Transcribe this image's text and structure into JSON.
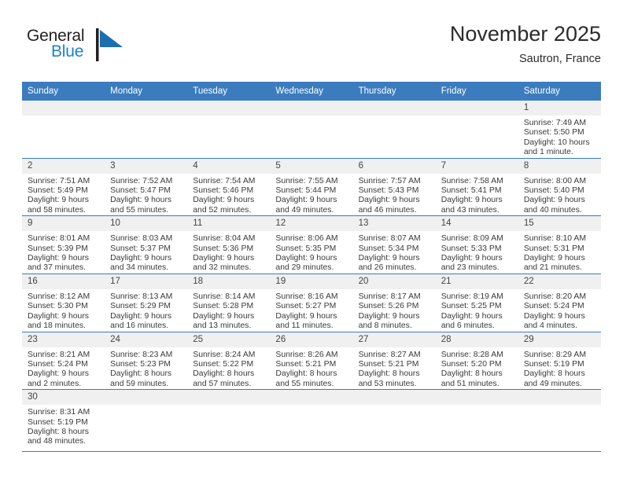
{
  "brand": {
    "name_part1": "General",
    "name_part2": "Blue",
    "flag_icon": "blue-flag-triangle",
    "color_black": "#231f20",
    "color_blue": "#1b82cb"
  },
  "header": {
    "title": "November 2025",
    "subtitle": "Sautron, France"
  },
  "theme": {
    "header_blue": "#3b7cbf",
    "daynum_gray": "#f0f0f0",
    "text": "#3a3a3a"
  },
  "weekdays": [
    "Sunday",
    "Monday",
    "Tuesday",
    "Wednesday",
    "Thursday",
    "Friday",
    "Saturday"
  ],
  "weeks": [
    [
      {
        "day": "",
        "empty": true
      },
      {
        "day": "",
        "empty": true
      },
      {
        "day": "",
        "empty": true
      },
      {
        "day": "",
        "empty": true
      },
      {
        "day": "",
        "empty": true
      },
      {
        "day": "",
        "empty": true
      },
      {
        "day": "1",
        "sunrise": "Sunrise: 7:49 AM",
        "sunset": "Sunset: 5:50 PM",
        "daylight1": "Daylight: 10 hours",
        "daylight2": "and 1 minute."
      }
    ],
    [
      {
        "day": "2",
        "sunrise": "Sunrise: 7:51 AM",
        "sunset": "Sunset: 5:49 PM",
        "daylight1": "Daylight: 9 hours",
        "daylight2": "and 58 minutes."
      },
      {
        "day": "3",
        "sunrise": "Sunrise: 7:52 AM",
        "sunset": "Sunset: 5:47 PM",
        "daylight1": "Daylight: 9 hours",
        "daylight2": "and 55 minutes."
      },
      {
        "day": "4",
        "sunrise": "Sunrise: 7:54 AM",
        "sunset": "Sunset: 5:46 PM",
        "daylight1": "Daylight: 9 hours",
        "daylight2": "and 52 minutes."
      },
      {
        "day": "5",
        "sunrise": "Sunrise: 7:55 AM",
        "sunset": "Sunset: 5:44 PM",
        "daylight1": "Daylight: 9 hours",
        "daylight2": "and 49 minutes."
      },
      {
        "day": "6",
        "sunrise": "Sunrise: 7:57 AM",
        "sunset": "Sunset: 5:43 PM",
        "daylight1": "Daylight: 9 hours",
        "daylight2": "and 46 minutes."
      },
      {
        "day": "7",
        "sunrise": "Sunrise: 7:58 AM",
        "sunset": "Sunset: 5:41 PM",
        "daylight1": "Daylight: 9 hours",
        "daylight2": "and 43 minutes."
      },
      {
        "day": "8",
        "sunrise": "Sunrise: 8:00 AM",
        "sunset": "Sunset: 5:40 PM",
        "daylight1": "Daylight: 9 hours",
        "daylight2": "and 40 minutes."
      }
    ],
    [
      {
        "day": "9",
        "sunrise": "Sunrise: 8:01 AM",
        "sunset": "Sunset: 5:39 PM",
        "daylight1": "Daylight: 9 hours",
        "daylight2": "and 37 minutes."
      },
      {
        "day": "10",
        "sunrise": "Sunrise: 8:03 AM",
        "sunset": "Sunset: 5:37 PM",
        "daylight1": "Daylight: 9 hours",
        "daylight2": "and 34 minutes."
      },
      {
        "day": "11",
        "sunrise": "Sunrise: 8:04 AM",
        "sunset": "Sunset: 5:36 PM",
        "daylight1": "Daylight: 9 hours",
        "daylight2": "and 32 minutes."
      },
      {
        "day": "12",
        "sunrise": "Sunrise: 8:06 AM",
        "sunset": "Sunset: 5:35 PM",
        "daylight1": "Daylight: 9 hours",
        "daylight2": "and 29 minutes."
      },
      {
        "day": "13",
        "sunrise": "Sunrise: 8:07 AM",
        "sunset": "Sunset: 5:34 PM",
        "daylight1": "Daylight: 9 hours",
        "daylight2": "and 26 minutes."
      },
      {
        "day": "14",
        "sunrise": "Sunrise: 8:09 AM",
        "sunset": "Sunset: 5:33 PM",
        "daylight1": "Daylight: 9 hours",
        "daylight2": "and 23 minutes."
      },
      {
        "day": "15",
        "sunrise": "Sunrise: 8:10 AM",
        "sunset": "Sunset: 5:31 PM",
        "daylight1": "Daylight: 9 hours",
        "daylight2": "and 21 minutes."
      }
    ],
    [
      {
        "day": "16",
        "sunrise": "Sunrise: 8:12 AM",
        "sunset": "Sunset: 5:30 PM",
        "daylight1": "Daylight: 9 hours",
        "daylight2": "and 18 minutes."
      },
      {
        "day": "17",
        "sunrise": "Sunrise: 8:13 AM",
        "sunset": "Sunset: 5:29 PM",
        "daylight1": "Daylight: 9 hours",
        "daylight2": "and 16 minutes."
      },
      {
        "day": "18",
        "sunrise": "Sunrise: 8:14 AM",
        "sunset": "Sunset: 5:28 PM",
        "daylight1": "Daylight: 9 hours",
        "daylight2": "and 13 minutes."
      },
      {
        "day": "19",
        "sunrise": "Sunrise: 8:16 AM",
        "sunset": "Sunset: 5:27 PM",
        "daylight1": "Daylight: 9 hours",
        "daylight2": "and 11 minutes."
      },
      {
        "day": "20",
        "sunrise": "Sunrise: 8:17 AM",
        "sunset": "Sunset: 5:26 PM",
        "daylight1": "Daylight: 9 hours",
        "daylight2": "and 8 minutes."
      },
      {
        "day": "21",
        "sunrise": "Sunrise: 8:19 AM",
        "sunset": "Sunset: 5:25 PM",
        "daylight1": "Daylight: 9 hours",
        "daylight2": "and 6 minutes."
      },
      {
        "day": "22",
        "sunrise": "Sunrise: 8:20 AM",
        "sunset": "Sunset: 5:24 PM",
        "daylight1": "Daylight: 9 hours",
        "daylight2": "and 4 minutes."
      }
    ],
    [
      {
        "day": "23",
        "sunrise": "Sunrise: 8:21 AM",
        "sunset": "Sunset: 5:24 PM",
        "daylight1": "Daylight: 9 hours",
        "daylight2": "and 2 minutes."
      },
      {
        "day": "24",
        "sunrise": "Sunrise: 8:23 AM",
        "sunset": "Sunset: 5:23 PM",
        "daylight1": "Daylight: 8 hours",
        "daylight2": "and 59 minutes."
      },
      {
        "day": "25",
        "sunrise": "Sunrise: 8:24 AM",
        "sunset": "Sunset: 5:22 PM",
        "daylight1": "Daylight: 8 hours",
        "daylight2": "and 57 minutes."
      },
      {
        "day": "26",
        "sunrise": "Sunrise: 8:26 AM",
        "sunset": "Sunset: 5:21 PM",
        "daylight1": "Daylight: 8 hours",
        "daylight2": "and 55 minutes."
      },
      {
        "day": "27",
        "sunrise": "Sunrise: 8:27 AM",
        "sunset": "Sunset: 5:21 PM",
        "daylight1": "Daylight: 8 hours",
        "daylight2": "and 53 minutes."
      },
      {
        "day": "28",
        "sunrise": "Sunrise: 8:28 AM",
        "sunset": "Sunset: 5:20 PM",
        "daylight1": "Daylight: 8 hours",
        "daylight2": "and 51 minutes."
      },
      {
        "day": "29",
        "sunrise": "Sunrise: 8:29 AM",
        "sunset": "Sunset: 5:19 PM",
        "daylight1": "Daylight: 8 hours",
        "daylight2": "and 49 minutes."
      }
    ],
    [
      {
        "day": "30",
        "sunrise": "Sunrise: 8:31 AM",
        "sunset": "Sunset: 5:19 PM",
        "daylight1": "Daylight: 8 hours",
        "daylight2": "and 48 minutes."
      },
      {
        "day": "",
        "empty": true
      },
      {
        "day": "",
        "empty": true
      },
      {
        "day": "",
        "empty": true
      },
      {
        "day": "",
        "empty": true
      },
      {
        "day": "",
        "empty": true
      },
      {
        "day": "",
        "empty": true
      }
    ]
  ]
}
